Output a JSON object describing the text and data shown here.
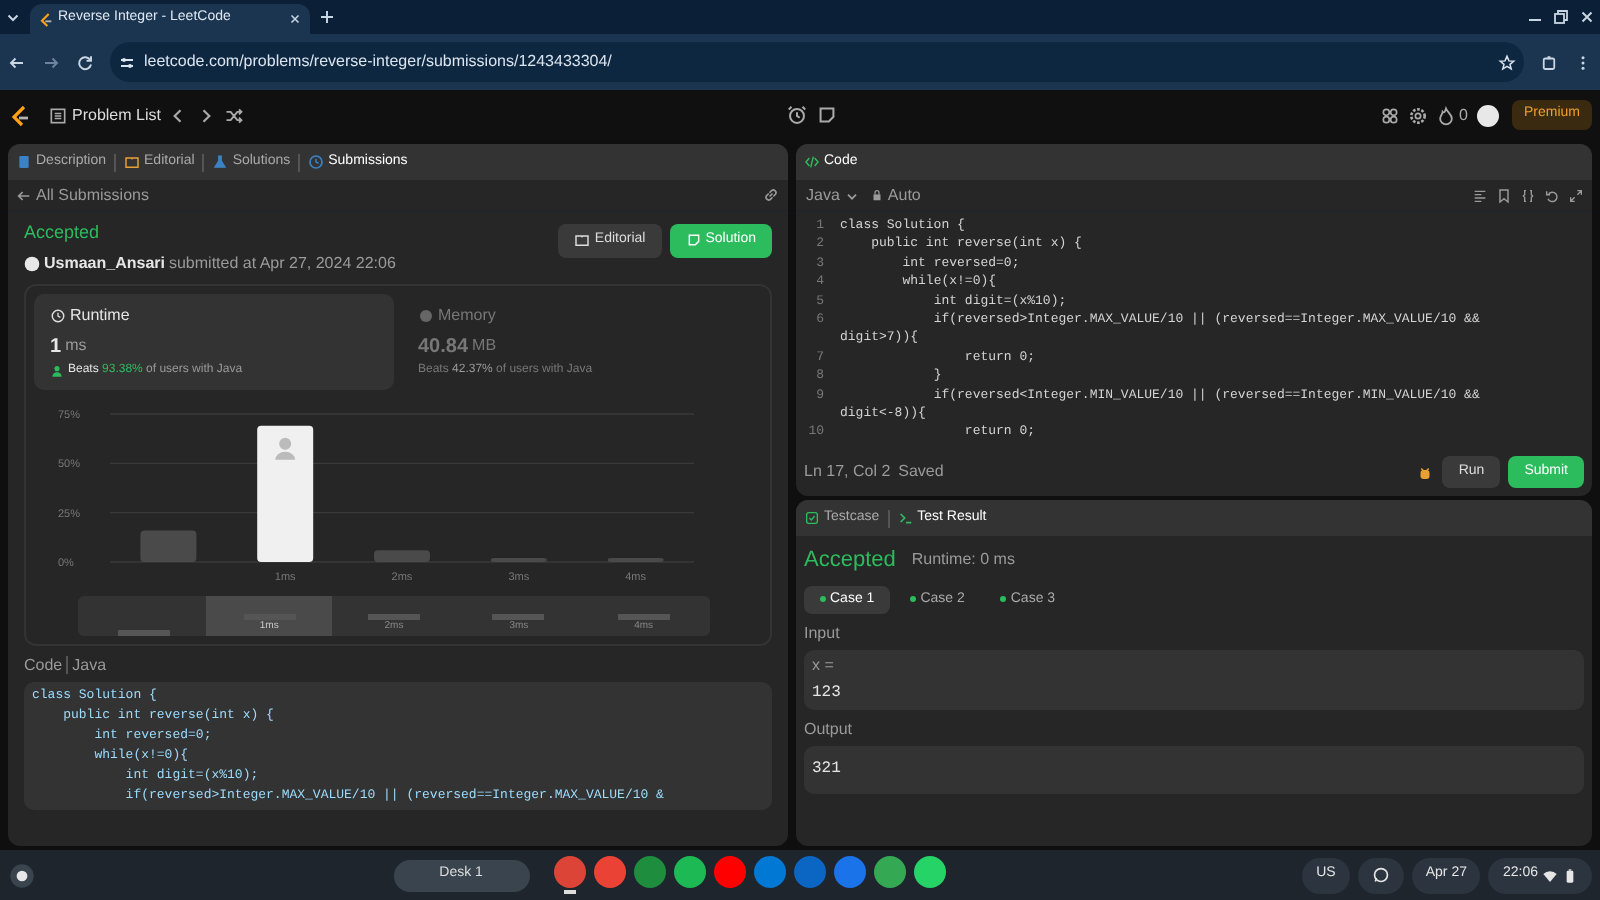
{
  "browser": {
    "tab_title": "Reverse Integer - LeetCode",
    "url": "leetcode.com/problems/reverse-integer/submissions/1243433304/"
  },
  "header": {
    "problem_list": "Problem List",
    "streak": "0",
    "premium": "Premium"
  },
  "left_tabs": [
    {
      "label": "Description",
      "selected": false
    },
    {
      "label": "Editorial",
      "selected": false
    },
    {
      "label": "Solutions",
      "selected": false
    },
    {
      "label": "Submissions",
      "selected": true
    }
  ],
  "back_link": "All Submissions",
  "submission": {
    "status": "Accepted",
    "user": "Usmaan_Ansari",
    "submitted": "submitted at Apr 27, 2024 22:06",
    "buttons": [
      {
        "label": "Editorial",
        "kind": "secondary"
      },
      {
        "label": "Solution",
        "kind": "primary"
      }
    ]
  },
  "stats": [
    {
      "title": "Runtime",
      "kind": "runtime",
      "value": "1",
      "unit": "ms",
      "beats_prefix": "Beats",
      "beats": "93.38%",
      "beats_suffix": "of users with Java",
      "selected": true
    },
    {
      "title": "Memory",
      "kind": "memory",
      "value": "40.84",
      "unit": "MB",
      "beats_prefix": "Beats",
      "beats": "42.37%",
      "beats_suffix": "of users with Java",
      "selected": false
    }
  ],
  "chart_data": {
    "type": "bar",
    "categories": [
      null,
      "1ms",
      "2ms",
      "3ms",
      "4ms"
    ],
    "values": [
      16,
      69,
      6,
      2,
      2
    ],
    "ylim": [
      0,
      75
    ],
    "yticks": [
      {
        "value": 0,
        "label": "0%"
      },
      {
        "value": 25,
        "label": "25%"
      },
      {
        "value": 50,
        "label": "50%"
      },
      {
        "value": 75,
        "label": "75%"
      }
    ]
  },
  "overview": {
    "labels": [
      "1ms",
      "2ms",
      "3ms",
      "4ms"
    ]
  },
  "code_header": {
    "label": "Code",
    "language": "Java"
  },
  "submitted_code": [
    "class Solution {",
    "    public int reverse(int x) {",
    "        int reversed=0;",
    "        while(x!=0){",
    "            int digit=(x%10);",
    "            if(reversed>Integer.MAX_VALUE/10 || (reversed==Integer.MAX_VALUE/10 &"
  ],
  "editor": {
    "title": "Code",
    "language": "Java",
    "mode": "Auto",
    "lines": [
      {
        "no": "1",
        "text": "class Solution {"
      },
      {
        "no": "2",
        "text": "    public int reverse(int x) {"
      },
      {
        "no": "3",
        "text": "        int reversed=0;"
      },
      {
        "no": "4",
        "text": "        while(x!=0){"
      },
      {
        "no": "5",
        "text": "            int digit=(x%10);"
      },
      {
        "no": "6",
        "text": "            if(reversed>Integer.MAX_VALUE/10 || (reversed==Integer.MAX_VALUE/10 && digit>7)){"
      },
      {
        "no": "7",
        "text": "                return 0;"
      },
      {
        "no": "8",
        "text": "            }"
      },
      {
        "no": "9",
        "text": "            if(reversed<Integer.MIN_VALUE/10 || (reversed==Integer.MIN_VALUE/10 && digit<-8)){"
      },
      {
        "no": "10",
        "text": "                return 0;"
      }
    ],
    "position": "Ln 17, Col 2",
    "save_state": "Saved",
    "buttons": [
      {
        "label": "Run",
        "kind": "secondary"
      },
      {
        "label": "Submit",
        "kind": "primary"
      }
    ]
  },
  "test_tabs": [
    {
      "label": "Testcase",
      "selected": false
    },
    {
      "label": "Test Result",
      "selected": true
    }
  ],
  "result": {
    "status": "Accepted",
    "runtime": "Runtime: 0 ms",
    "cases": [
      {
        "label": "Case 1",
        "passed": true,
        "selected": true
      },
      {
        "label": "Case 2",
        "passed": true,
        "selected": false
      },
      {
        "label": "Case 3",
        "passed": true,
        "selected": false
      }
    ],
    "input_label": "Input",
    "input_var": "x =",
    "input_value": "123",
    "output_label": "Output",
    "output_value": "321"
  },
  "taskbar": {
    "desk": "Desk 1",
    "apps": [
      {
        "color": "#db4437",
        "open": true
      },
      {
        "color": "#ea4335",
        "open": false
      },
      {
        "color": "#1e8e3e",
        "open": false
      },
      {
        "color": "#1db954",
        "open": false
      },
      {
        "color": "#ff0000",
        "open": false
      },
      {
        "color": "#0078d4",
        "open": false
      },
      {
        "color": "#0a66c2",
        "open": false
      },
      {
        "color": "#1a73e8",
        "open": false
      },
      {
        "color": "#34a853",
        "open": false
      },
      {
        "color": "#25d366",
        "open": false
      }
    ],
    "keyboard": "US",
    "date": "Apr 27",
    "time": "22:06"
  }
}
